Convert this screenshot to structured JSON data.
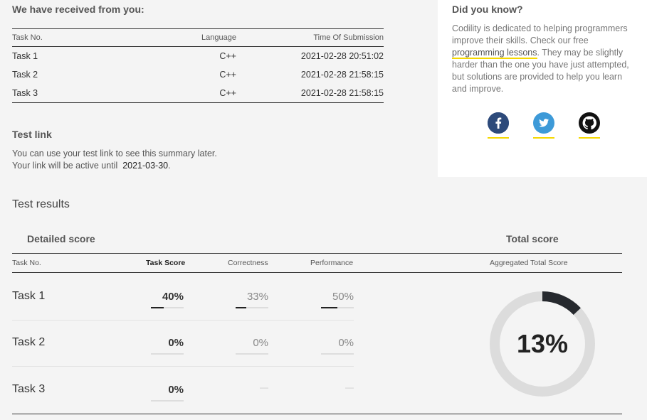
{
  "received": {
    "title": "We have received from you:",
    "headers": {
      "task": "Task No.",
      "language": "Language",
      "time": "Time Of Submission"
    },
    "rows": [
      {
        "task": "Task 1",
        "language": "C++",
        "time": "2021-02-28 20:51:02"
      },
      {
        "task": "Task 2",
        "language": "C++",
        "time": "2021-02-28 21:58:15"
      },
      {
        "task": "Task 3",
        "language": "C++",
        "time": "2021-02-28 21:58:15"
      }
    ]
  },
  "test_link": {
    "title": "Test link",
    "line1": "You can use your test link to see this summary later.",
    "line2_prefix": "Your link will be active until",
    "date": "2021-03-30",
    "line2_suffix": "."
  },
  "did_you_know": {
    "title": "Did you know?",
    "text_before": "Codility is dedicated to helping programmers improve their skills. Check our free ",
    "link": "programming lessons",
    "text_after": ". They may be slightly harder than the one you have just attempted, but solutions are provided to help you learn and improve.",
    "social": [
      {
        "icon": "facebook-icon",
        "glyph": "f",
        "color": "#3b5998"
      },
      {
        "icon": "twitter-icon",
        "glyph": "t",
        "color": "#1da1f2"
      },
      {
        "icon": "github-icon",
        "glyph": "g",
        "color": "#111111"
      }
    ]
  },
  "results": {
    "title": "Test results",
    "detailed_title": "Detailed score",
    "total_title": "Total score",
    "headers": {
      "task": "Task No.",
      "task_score": "Task Score",
      "correctness": "Correctness",
      "performance": "Performance",
      "aggregated": "Aggregated Total Score"
    },
    "rows": [
      {
        "task": "Task 1",
        "score": "40%",
        "score_value": 40,
        "correctness": "33%",
        "correctness_value": 33,
        "performance": "50%",
        "performance_value": 50
      },
      {
        "task": "Task 2",
        "score": "0%",
        "score_value": 0,
        "correctness": "0%",
        "correctness_value": 0,
        "performance": "0%",
        "performance_value": 0
      },
      {
        "task": "Task 3",
        "score": "0%",
        "score_value": 0,
        "correctness": "—",
        "correctness_value": null,
        "performance": "—",
        "performance_value": null
      }
    ],
    "total": "13%",
    "total_value": 13
  }
}
